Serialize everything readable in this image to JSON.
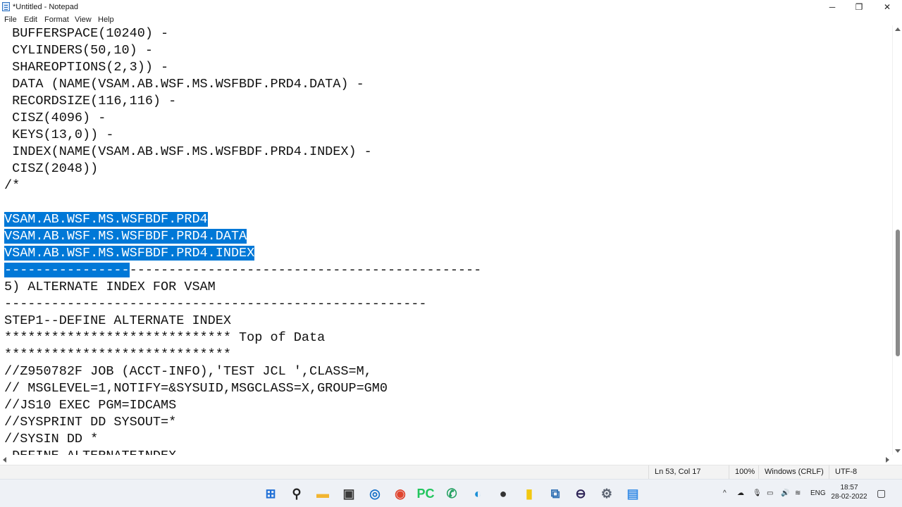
{
  "window": {
    "title": "*Untitled - Notepad",
    "controls": {
      "minimize": "─",
      "maximize": "❐",
      "close": "✕"
    }
  },
  "menu": [
    "File",
    "Edit",
    "Format",
    "View",
    "Help"
  ],
  "editor": {
    "lines": [
      [
        {
          "t": " BUFFERSPACE(10240) -"
        }
      ],
      [
        {
          "t": " CYLINDERS(50,10) -"
        }
      ],
      [
        {
          "t": " SHAREOPTIONS(2,3)) -"
        }
      ],
      [
        {
          "t": " DATA (NAME(VSAM.AB.WSF.MS.WSFBDF.PRD4.DATA) -"
        }
      ],
      [
        {
          "t": " RECORDSIZE(116,116) -"
        }
      ],
      [
        {
          "t": " CISZ(4096) -"
        }
      ],
      [
        {
          "t": " KEYS(13,0)) -"
        }
      ],
      [
        {
          "t": " INDEX(NAME(VSAM.AB.WSF.MS.WSFBDF.PRD4.INDEX) -"
        }
      ],
      [
        {
          "t": " CISZ(2048))"
        }
      ],
      [
        {
          "t": "/*"
        }
      ],
      [
        {
          "t": ""
        }
      ],
      [
        {
          "t": "VSAM.AB.WSF.MS.WSFBDF.PRD4",
          "s": true
        }
      ],
      [
        {
          "t": "VSAM.AB.WSF.MS.WSFBDF.PRD4.DATA",
          "s": true
        }
      ],
      [
        {
          "t": "VSAM.AB.WSF.MS.WSFBDF.PRD4.INDEX",
          "s": true
        }
      ],
      [
        {
          "t": "----------------",
          "s": true
        },
        {
          "t": "---------------------------------------------"
        }
      ],
      [
        {
          "t": "5) ALTERNATE INDEX FOR VSAM"
        }
      ],
      [
        {
          "t": "------------------------------------------------------"
        }
      ],
      [
        {
          "t": "STEP1--DEFINE ALTERNATE INDEX"
        }
      ],
      [
        {
          "t": "***************************** Top of Data"
        }
      ],
      [
        {
          "t": "*****************************"
        }
      ],
      [
        {
          "t": "//Z950782F JOB (ACCT-INFO),'TEST JCL ',CLASS=M,"
        }
      ],
      [
        {
          "t": "// MSGLEVEL=1,NOTIFY=&SYSUID,MSGCLASS=X,GROUP=GM0"
        }
      ],
      [
        {
          "t": "//JS10 EXEC PGM=IDCAMS"
        }
      ],
      [
        {
          "t": "//SYSPRINT DD SYSOUT=*"
        }
      ],
      [
        {
          "t": "//SYSIN DD *"
        }
      ],
      [
        {
          "t": " DEFINE ALTERNATEINDEX -"
        }
      ]
    ]
  },
  "status": {
    "position": "Ln 53, Col 17",
    "zoom": "100%",
    "line_ending": "Windows (CRLF)",
    "encoding": "UTF-8"
  },
  "taskbar": {
    "apps": [
      {
        "name": "start-icon",
        "glyph": "⊞",
        "color": "#1f6fd6"
      },
      {
        "name": "search-icon",
        "glyph": "⚲",
        "color": "#222222"
      },
      {
        "name": "file-explorer-icon",
        "glyph": "▬",
        "color": "#f2b531"
      },
      {
        "name": "store-icon",
        "glyph": "▣",
        "color": "#3a3a3a"
      },
      {
        "name": "edge-dev-icon",
        "glyph": "◎",
        "color": "#1a73c9"
      },
      {
        "name": "chrome-icon",
        "glyph": "◉",
        "color": "#e0452f"
      },
      {
        "name": "pycharm-icon",
        "glyph": "PC",
        "color": "#21c55d"
      },
      {
        "name": "whatsapp-icon",
        "glyph": "✆",
        "color": "#25a162"
      },
      {
        "name": "edge-icon",
        "glyph": "◐",
        "color": "#1b8fd6"
      },
      {
        "name": "github-desktop-icon",
        "glyph": "●",
        "color": "#333333"
      },
      {
        "name": "powerbi-icon",
        "glyph": "▮",
        "color": "#f2c811"
      },
      {
        "name": "remote-desktop-icon",
        "glyph": "⧉",
        "color": "#2f6fb3"
      },
      {
        "name": "eclipse-icon",
        "glyph": "⊖",
        "color": "#2c2255"
      },
      {
        "name": "settings-icon",
        "glyph": "⚙",
        "color": "#5a6270"
      },
      {
        "name": "notepad-icon",
        "glyph": "▤",
        "color": "#3a8ee6"
      }
    ],
    "tray": {
      "chevron": "^",
      "language": "ENG",
      "time": "18:57",
      "date": "28-02-2022"
    }
  }
}
